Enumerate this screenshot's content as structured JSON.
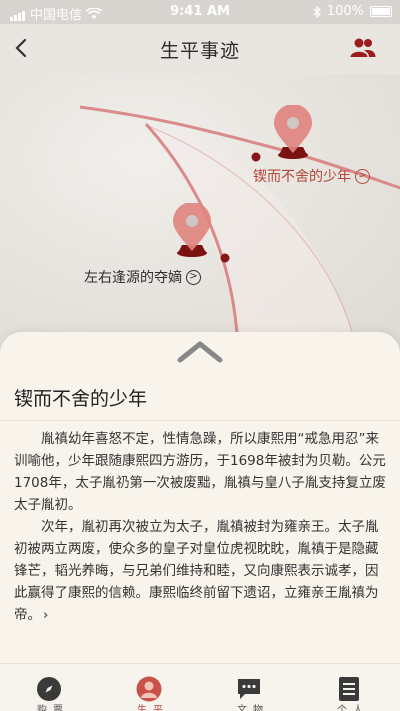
{
  "status_bar": {
    "carrier": "中国电信",
    "time": "9:41 AM",
    "battery": "100%"
  },
  "nav": {
    "title": "生平事迹"
  },
  "map": {
    "pins": [
      {
        "label": "锲而不舍的少年",
        "label_color": "#b5463a"
      },
      {
        "label": "左右逢源的夺嫡",
        "label_color": "#2f2f2f"
      }
    ],
    "route_color": "#d98a8a",
    "pin_color": "#e08480",
    "pin_base_color": "#7a1212"
  },
  "sheet": {
    "title": "锲而不舍的少年",
    "paragraphs": [
      "胤禛幼年喜怒不定，性情急躁，所以康熙用“戒急用忍”来训喻他，少年跟随康熙四方游历，于1698年被封为贝勒。公元1708年，太子胤礽第一次被废黜，胤禛与皇八子胤支持复立废太子胤初。",
      "次年，胤初再次被立为太子，胤禛被封为雍亲王。太子胤初被两立两废，使众多的皇子对皇位虎视眈眈，胤禛于是隐藏锋芒，韬光养晦，与兄弟们维持和睦，又向康熙表示诚孝，因此赢得了康熙的信赖。康熙临终前留下遗诏，立雍亲王胤禛为帝。"
    ],
    "more": "›"
  },
  "tabs": [
    {
      "label": "购票",
      "icon": "compass-icon",
      "active": false
    },
    {
      "label": "生平",
      "icon": "person-icon",
      "active": true
    },
    {
      "label": "文物",
      "icon": "chat-icon",
      "active": false
    },
    {
      "label": "个人",
      "icon": "document-icon",
      "active": false
    }
  ],
  "colors": {
    "accent": "#b84a3f",
    "icon_dark": "#3a3a3a"
  }
}
